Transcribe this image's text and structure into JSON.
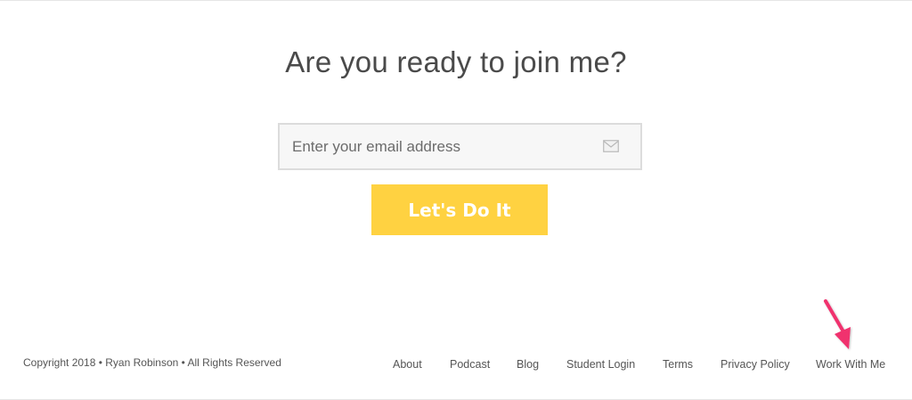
{
  "cta": {
    "heading": "Are you ready to join me?",
    "email_placeholder": "Enter your email address",
    "email_value": "",
    "submit_label": "Let's Do It",
    "button_color": "#ffd241"
  },
  "footer": {
    "copyright": "Copyright 2018 • Ryan Robinson • All Rights Reserved",
    "links": [
      {
        "label": "About"
      },
      {
        "label": "Podcast"
      },
      {
        "label": "Blog"
      },
      {
        "label": "Student Login"
      },
      {
        "label": "Terms"
      },
      {
        "label": "Privacy Policy"
      },
      {
        "label": "Work With Me"
      }
    ]
  },
  "annotation": {
    "icon": "arrow-icon",
    "color": "#f0306e"
  }
}
